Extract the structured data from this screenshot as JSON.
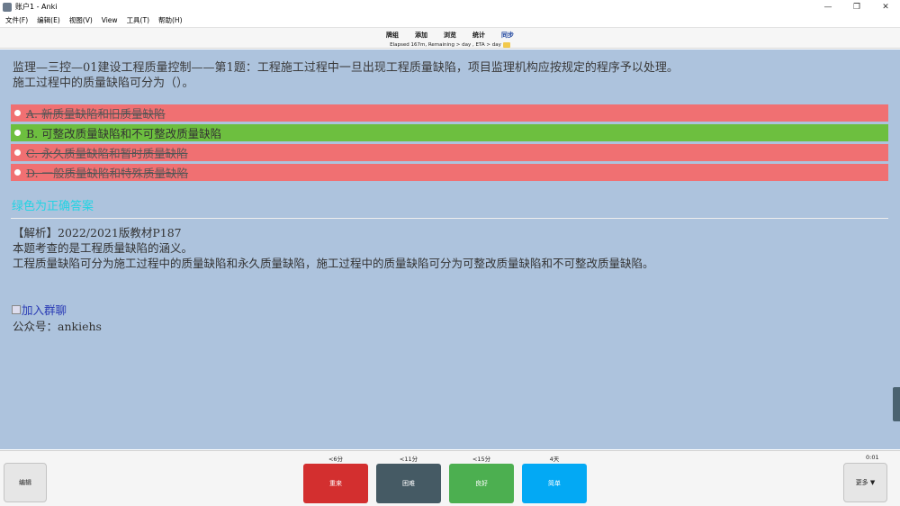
{
  "window": {
    "title": "账户1 - Anki",
    "minimize": "—",
    "maximize": "❐",
    "close": "✕"
  },
  "menu": [
    "文件(F)",
    "编辑(E)",
    "视图(V)",
    "View",
    "工具(T)",
    "帮助(H)"
  ],
  "toolbar": {
    "decks": "牌组",
    "add": "添加",
    "browse": "浏览",
    "stats": "统计",
    "sync": "同步"
  },
  "progress": {
    "text": "Elapsed 167m, Remaining > day , ETA > day"
  },
  "card": {
    "question_line1": "监理—三控—01建设工程质量控制——第1题：工程施工过程中一旦出现工程质量缺陷，项目监理机构应按规定的程序予以处理。",
    "question_line2": "施工过程中的质量缺陷可分为（）。",
    "options": [
      {
        "text": "A. 新质量缺陷和旧质量缺陷",
        "status": "wrong"
      },
      {
        "text": "B. 可整改质量缺陷和不可整改质量缺陷",
        "status": "correct"
      },
      {
        "text": "C. 永久质量缺陷和暂时质量缺陷",
        "status": "wrong"
      },
      {
        "text": "D. 一般质量缺陷和特殊质量缺陷",
        "status": "wrong"
      }
    ],
    "reveal_text": "绿色为正确答案",
    "explain_line1": "【解析】2022/2021版教材P187",
    "explain_line2": "本题考查的是工程质量缺陷的涵义。",
    "explain_line3": "工程质量缺陷可分为施工过程中的质量缺陷和永久质量缺陷，施工过程中的质量缺陷可分为可整改质量缺陷和不可整改质量缺陷。",
    "group_link": "加入群聊",
    "gzh": "公众号：ankiehs"
  },
  "bottom": {
    "edit": "编辑",
    "more": "更多 ▼",
    "timer": "0:01",
    "buttons": [
      {
        "label": "重来",
        "interval": "<6分",
        "color": "#d32f2f"
      },
      {
        "label": "困难",
        "interval": "<11分",
        "color": "#455a64"
      },
      {
        "label": "良好",
        "interval": "<15分",
        "color": "#4caf50"
      },
      {
        "label": "简单",
        "interval": "4天",
        "color": "#03a9f4"
      }
    ]
  }
}
